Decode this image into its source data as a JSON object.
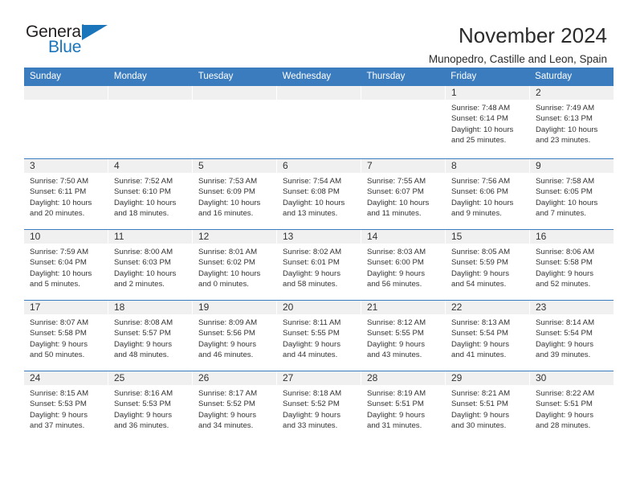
{
  "brand": {
    "name_part1": "General",
    "name_part2": "Blue",
    "accent_color": "#1b75bb"
  },
  "header": {
    "month_title": "November 2024",
    "location": "Munopedro, Castille and Leon, Spain"
  },
  "theme": {
    "header_blue": "#3b7cbf",
    "daynum_band": "#f0f0f0",
    "text": "#333333"
  },
  "weekdays": [
    "Sunday",
    "Monday",
    "Tuesday",
    "Wednesday",
    "Thursday",
    "Friday",
    "Saturday"
  ],
  "weeks": [
    [
      {
        "day": "",
        "lines": []
      },
      {
        "day": "",
        "lines": []
      },
      {
        "day": "",
        "lines": []
      },
      {
        "day": "",
        "lines": []
      },
      {
        "day": "",
        "lines": []
      },
      {
        "day": "1",
        "lines": [
          "Sunrise: 7:48 AM",
          "Sunset: 6:14 PM",
          "Daylight: 10 hours",
          "and 25 minutes."
        ]
      },
      {
        "day": "2",
        "lines": [
          "Sunrise: 7:49 AM",
          "Sunset: 6:13 PM",
          "Daylight: 10 hours",
          "and 23 minutes."
        ]
      }
    ],
    [
      {
        "day": "3",
        "lines": [
          "Sunrise: 7:50 AM",
          "Sunset: 6:11 PM",
          "Daylight: 10 hours",
          "and 20 minutes."
        ]
      },
      {
        "day": "4",
        "lines": [
          "Sunrise: 7:52 AM",
          "Sunset: 6:10 PM",
          "Daylight: 10 hours",
          "and 18 minutes."
        ]
      },
      {
        "day": "5",
        "lines": [
          "Sunrise: 7:53 AM",
          "Sunset: 6:09 PM",
          "Daylight: 10 hours",
          "and 16 minutes."
        ]
      },
      {
        "day": "6",
        "lines": [
          "Sunrise: 7:54 AM",
          "Sunset: 6:08 PM",
          "Daylight: 10 hours",
          "and 13 minutes."
        ]
      },
      {
        "day": "7",
        "lines": [
          "Sunrise: 7:55 AM",
          "Sunset: 6:07 PM",
          "Daylight: 10 hours",
          "and 11 minutes."
        ]
      },
      {
        "day": "8",
        "lines": [
          "Sunrise: 7:56 AM",
          "Sunset: 6:06 PM",
          "Daylight: 10 hours",
          "and 9 minutes."
        ]
      },
      {
        "day": "9",
        "lines": [
          "Sunrise: 7:58 AM",
          "Sunset: 6:05 PM",
          "Daylight: 10 hours",
          "and 7 minutes."
        ]
      }
    ],
    [
      {
        "day": "10",
        "lines": [
          "Sunrise: 7:59 AM",
          "Sunset: 6:04 PM",
          "Daylight: 10 hours",
          "and 5 minutes."
        ]
      },
      {
        "day": "11",
        "lines": [
          "Sunrise: 8:00 AM",
          "Sunset: 6:03 PM",
          "Daylight: 10 hours",
          "and 2 minutes."
        ]
      },
      {
        "day": "12",
        "lines": [
          "Sunrise: 8:01 AM",
          "Sunset: 6:02 PM",
          "Daylight: 10 hours",
          "and 0 minutes."
        ]
      },
      {
        "day": "13",
        "lines": [
          "Sunrise: 8:02 AM",
          "Sunset: 6:01 PM",
          "Daylight: 9 hours",
          "and 58 minutes."
        ]
      },
      {
        "day": "14",
        "lines": [
          "Sunrise: 8:03 AM",
          "Sunset: 6:00 PM",
          "Daylight: 9 hours",
          "and 56 minutes."
        ]
      },
      {
        "day": "15",
        "lines": [
          "Sunrise: 8:05 AM",
          "Sunset: 5:59 PM",
          "Daylight: 9 hours",
          "and 54 minutes."
        ]
      },
      {
        "day": "16",
        "lines": [
          "Sunrise: 8:06 AM",
          "Sunset: 5:58 PM",
          "Daylight: 9 hours",
          "and 52 minutes."
        ]
      }
    ],
    [
      {
        "day": "17",
        "lines": [
          "Sunrise: 8:07 AM",
          "Sunset: 5:58 PM",
          "Daylight: 9 hours",
          "and 50 minutes."
        ]
      },
      {
        "day": "18",
        "lines": [
          "Sunrise: 8:08 AM",
          "Sunset: 5:57 PM",
          "Daylight: 9 hours",
          "and 48 minutes."
        ]
      },
      {
        "day": "19",
        "lines": [
          "Sunrise: 8:09 AM",
          "Sunset: 5:56 PM",
          "Daylight: 9 hours",
          "and 46 minutes."
        ]
      },
      {
        "day": "20",
        "lines": [
          "Sunrise: 8:11 AM",
          "Sunset: 5:55 PM",
          "Daylight: 9 hours",
          "and 44 minutes."
        ]
      },
      {
        "day": "21",
        "lines": [
          "Sunrise: 8:12 AM",
          "Sunset: 5:55 PM",
          "Daylight: 9 hours",
          "and 43 minutes."
        ]
      },
      {
        "day": "22",
        "lines": [
          "Sunrise: 8:13 AM",
          "Sunset: 5:54 PM",
          "Daylight: 9 hours",
          "and 41 minutes."
        ]
      },
      {
        "day": "23",
        "lines": [
          "Sunrise: 8:14 AM",
          "Sunset: 5:54 PM",
          "Daylight: 9 hours",
          "and 39 minutes."
        ]
      }
    ],
    [
      {
        "day": "24",
        "lines": [
          "Sunrise: 8:15 AM",
          "Sunset: 5:53 PM",
          "Daylight: 9 hours",
          "and 37 minutes."
        ]
      },
      {
        "day": "25",
        "lines": [
          "Sunrise: 8:16 AM",
          "Sunset: 5:53 PM",
          "Daylight: 9 hours",
          "and 36 minutes."
        ]
      },
      {
        "day": "26",
        "lines": [
          "Sunrise: 8:17 AM",
          "Sunset: 5:52 PM",
          "Daylight: 9 hours",
          "and 34 minutes."
        ]
      },
      {
        "day": "27",
        "lines": [
          "Sunrise: 8:18 AM",
          "Sunset: 5:52 PM",
          "Daylight: 9 hours",
          "and 33 minutes."
        ]
      },
      {
        "day": "28",
        "lines": [
          "Sunrise: 8:19 AM",
          "Sunset: 5:51 PM",
          "Daylight: 9 hours",
          "and 31 minutes."
        ]
      },
      {
        "day": "29",
        "lines": [
          "Sunrise: 8:21 AM",
          "Sunset: 5:51 PM",
          "Daylight: 9 hours",
          "and 30 minutes."
        ]
      },
      {
        "day": "30",
        "lines": [
          "Sunrise: 8:22 AM",
          "Sunset: 5:51 PM",
          "Daylight: 9 hours",
          "and 28 minutes."
        ]
      }
    ]
  ]
}
